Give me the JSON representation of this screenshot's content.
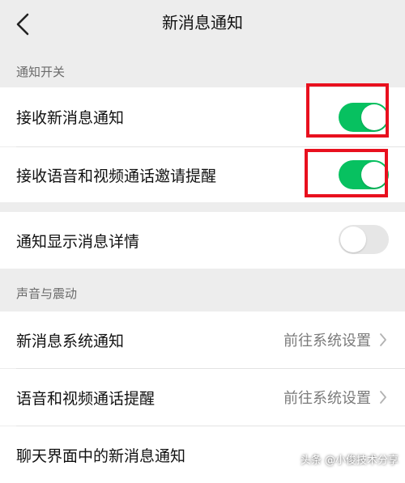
{
  "header": {
    "title": "新消息通知",
    "back_icon": "chevron-left-icon"
  },
  "sections": {
    "notify_switch": "通知开关",
    "sound_vibration": "声音与震动"
  },
  "rows": {
    "receive_new": {
      "label": "接收新消息通知",
      "enabled": true
    },
    "receive_call": {
      "label": "接收语音和视频通话邀请提醒",
      "enabled": true
    },
    "show_details": {
      "label": "通知显示消息详情",
      "enabled": false
    },
    "system_notify": {
      "label": "新消息系统通知",
      "link": "前往系统设置"
    },
    "call_reminder": {
      "label": "语音和视频通话提醒",
      "link": "前往系统设置"
    },
    "chat_notify": {
      "label": "聊天界面中的新消息通知"
    }
  },
  "watermark": {
    "text": "头条 @小俊技术分享"
  },
  "colors": {
    "toggle_on": "#07c160",
    "toggle_off": "#e6e6e6",
    "highlight": "#e8101e",
    "background": "#ededed"
  }
}
